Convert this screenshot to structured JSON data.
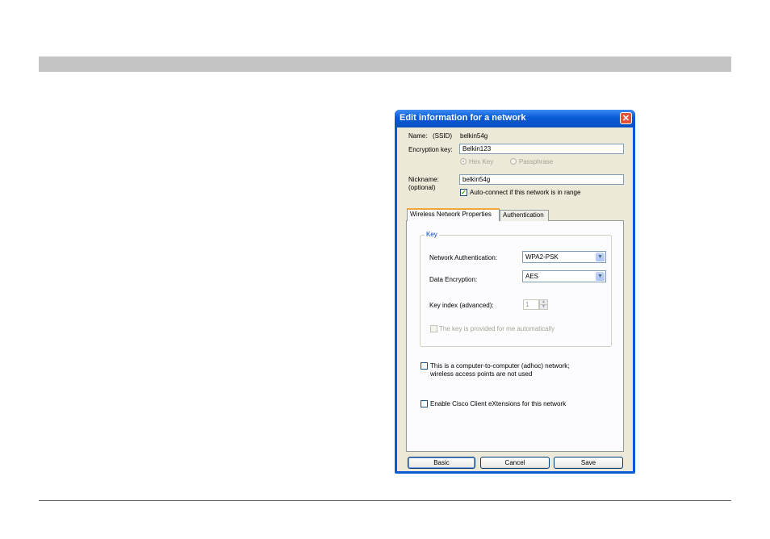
{
  "dialog": {
    "title": "Edit information for a network",
    "close_icon": "close-icon"
  },
  "fields": {
    "name_label": "Name:",
    "ssid_label": "(SSID)",
    "ssid_value": "belkin54g",
    "encryption_key_label": "Encryption key:",
    "encryption_key_value": "Belkin123",
    "hex_key_label": "Hex Key",
    "passphrase_label": "Passphrase",
    "selected_key_type": "Hex Key",
    "nickname_label": "Nickname:",
    "nickname_optional": "(optional)",
    "nickname_value": "belkin54g",
    "auto_connect_label": "Auto-connect if this network is in range",
    "auto_connect_checked": true
  },
  "tabs": [
    {
      "label": "Wireless Network Properties",
      "active": true
    },
    {
      "label": "Authentication",
      "active": false
    }
  ],
  "key_group": {
    "title": "Key",
    "network_auth_label": "Network Authentication:",
    "network_auth_value": "WPA2-PSK",
    "data_encryption_label": "Data Encryption:",
    "data_encryption_value": "AES",
    "key_index_label": "Key index (advanced):",
    "key_index_value": "1",
    "auto_key_label": "The key is provided for me automatically",
    "auto_key_checked": false
  },
  "options": {
    "adhoc_label_line1": "This is a computer-to-computer (adhoc) network;",
    "adhoc_label_line2": "wireless access points are not used",
    "adhoc_checked": false,
    "cisco_label": "Enable Cisco Client eXtensions for this network",
    "cisco_checked": false
  },
  "buttons": {
    "basic": "Basic",
    "cancel": "Cancel",
    "save": "Save"
  },
  "colors": {
    "title_bar": "#0a5ad6",
    "dialog_face": "#ece9d8",
    "close_button": "#e0553a",
    "active_tab_accent": "#f6a638",
    "page_header_bar": "#c3c3c3"
  }
}
